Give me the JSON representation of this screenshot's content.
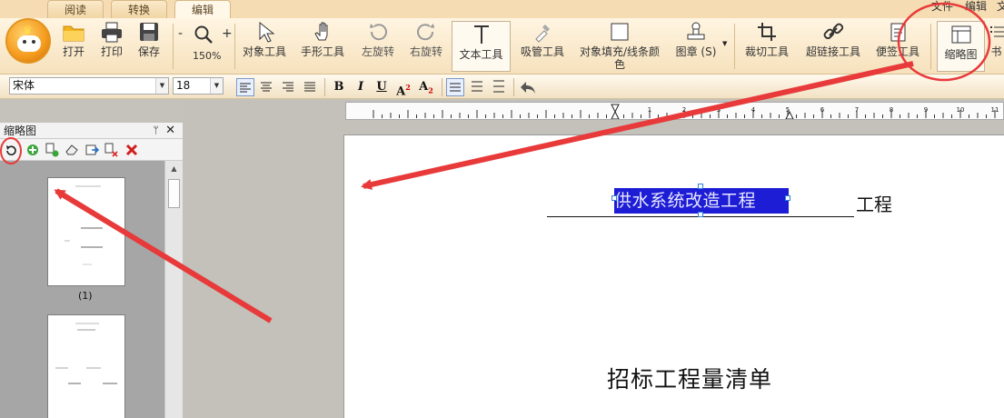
{
  "tabs": [
    {
      "label": "阅读",
      "active": false
    },
    {
      "label": "转换",
      "active": false
    },
    {
      "label": "编辑",
      "active": true
    }
  ],
  "top_menu": {
    "file": "文件",
    "edit": "编辑",
    "cut": "文"
  },
  "toolbar": {
    "open": "打开",
    "print": "打印",
    "save": "保存",
    "zoom_minus": "-",
    "zoom_plus": "+",
    "zoom_level": "150%",
    "object_tool": "对象工具",
    "hand_tool": "手形工具",
    "rotate_left": "左旋转",
    "rotate_right": "右旋转",
    "text_tool": "文本工具",
    "eyedropper": "吸管工具",
    "fill_line": "对象填充/线条颜色",
    "stamp": "图章 (S)",
    "crop": "裁切工具",
    "hyperlink": "超链接工具",
    "note": "便签工具",
    "thumbnail": "缩略图",
    "bookmark": "书"
  },
  "format": {
    "font_name": "宋体",
    "font_size": "18",
    "bold": "B",
    "italic": "I",
    "underline": "U",
    "superscript_base": "A",
    "superscript_mark": "2",
    "subscript_base": "A",
    "subscript_mark": "2"
  },
  "panel": {
    "title": "缩略图",
    "pin": "ᛘ",
    "close": "✕",
    "thumbnails": [
      {
        "label": "(1)"
      }
    ]
  },
  "ruler": {
    "labels": [
      "1",
      "2",
      "3",
      "4",
      "5",
      "6",
      "7",
      "8",
      "9",
      "10",
      "11"
    ]
  },
  "document": {
    "selected_text": "供水系统改造工程",
    "suffix": "工程",
    "title": "招标工程量清单"
  },
  "colors": {
    "accent": "#e83a3a",
    "selection": "#1d1dd6",
    "ribbon": "#f6e1bc"
  }
}
